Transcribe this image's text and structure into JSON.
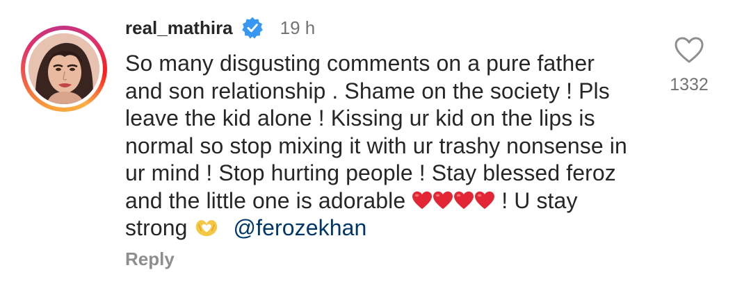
{
  "comment": {
    "username": "real_mathira",
    "verified": true,
    "time": "19 h",
    "lines": [
      "So many disgusting comments on a pure father",
      "and son relationship . Shame on the society ! Pls",
      "leave the kid alone ! Kissing ur kid on the lips is",
      "normal so stop mixing it with ur trashy nonsense in",
      "ur mind ! Stop hurting people ! Stay blessed feroz",
      "and the little one is adorable",
      "! U stay",
      "strong"
    ],
    "mention": "@ferozekhan",
    "emojis": {
      "hearts": [
        "red-heart",
        "red-heart",
        "red-heart",
        "red-heart"
      ],
      "hand": "heart-hands"
    },
    "reply_label": "Reply",
    "like_count": "1332"
  },
  "colors": {
    "verified_badge": "#3897f0",
    "mention": "#00376b",
    "heart_emoji": "#e32636"
  }
}
